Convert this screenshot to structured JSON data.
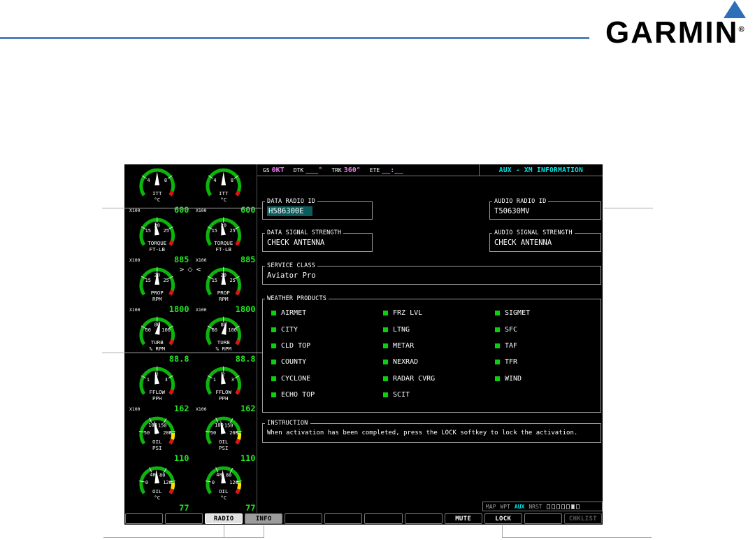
{
  "branding": {
    "logo_text": "GARMIN",
    "registered_mark": "®"
  },
  "colors": {
    "rule_blue": "#4f81bd",
    "garmin_delta_blue": "#2e6fb7",
    "accent_cyan": "#00e5e5",
    "nav_value_magenta": "#e87ae8",
    "gauge_value_green": "#23e523",
    "indicator_green": "#0ad20a",
    "cursor_highlight_teal": "#0d5c5c"
  },
  "navbar": {
    "fields": [
      {
        "label": "GS",
        "value": "0KT"
      },
      {
        "label": "DTK",
        "value": "___°"
      },
      {
        "label": "TRK",
        "value": "360°"
      },
      {
        "label": "ETE",
        "value": "__:__"
      }
    ],
    "title": "AUX - XM INFORMATION"
  },
  "eis": {
    "prop_sync": "> ◇ <",
    "rows": [
      {
        "name": "ITT",
        "unit": "°C",
        "sub": "X100",
        "ticks": [
          "4",
          "8"
        ],
        "value": "600",
        "needle": 0,
        "yellow": false,
        "sync": false
      },
      {
        "name": "TORQUE",
        "unit": "FT-LB",
        "sub": "X100",
        "ticks": [
          "15",
          "20",
          "25"
        ],
        "value": "885",
        "needle": -8,
        "yellow": false,
        "sync": false
      },
      {
        "name": "PROP",
        "unit": "RPM",
        "sub": "X100",
        "ticks": [
          "15",
          "20",
          "25"
        ],
        "value": "1800",
        "needle": 0,
        "yellow": false,
        "sync": true
      },
      {
        "name": "TURB",
        "unit": "% RPM",
        "sub": "",
        "ticks": [
          "60",
          "80",
          "100"
        ],
        "value": "88.8",
        "needle": 12,
        "yellow": false,
        "sync": false
      },
      {
        "name": "FFLOW",
        "unit": "PPH",
        "sub": "X100",
        "ticks": [
          "1",
          "2",
          "3"
        ],
        "value": "162",
        "needle": -8,
        "yellow": false,
        "sync": false
      },
      {
        "name": "OIL",
        "unit": "PSI",
        "sub": "",
        "ticks": [
          "50",
          "100",
          "150",
          "200"
        ],
        "value": "110",
        "needle": -12,
        "yellow": true,
        "sync": false
      },
      {
        "name": "OIL",
        "unit": "°C",
        "sub": "",
        "ticks": [
          "0",
          "40",
          "80",
          "120"
        ],
        "value": "77",
        "needle": -4,
        "yellow": true,
        "sync": false
      }
    ]
  },
  "fields": {
    "data_radio_id": {
      "label": "DATA RADIO ID",
      "value": "H586300E"
    },
    "audio_radio_id": {
      "label": "AUDIO RADIO ID",
      "value": "T50630MV"
    },
    "data_signal": {
      "label": "DATA SIGNAL STRENGTH",
      "value": "CHECK ANTENNA"
    },
    "audio_signal": {
      "label": "AUDIO SIGNAL STRENGTH",
      "value": "CHECK ANTENNA"
    },
    "service_class": {
      "label": "SERVICE CLASS",
      "value": "Aviator Pro"
    }
  },
  "weather_products": {
    "label": "WEATHER PRODUCTS",
    "columns": [
      [
        "AIRMET",
        "CITY",
        "CLD TOP",
        "COUNTY",
        "CYCLONE",
        "ECHO TOP"
      ],
      [
        "FRZ LVL",
        "LTNG",
        "METAR",
        "NEXRAD",
        "RADAR CVRG",
        "SCIT"
      ],
      [
        "SIGMET",
        "SFC",
        "TAF",
        "TFR",
        "WIND"
      ]
    ]
  },
  "instruction": {
    "label": "INSTRUCTION",
    "text": "When activation has been completed, press the LOCK softkey to lock the activation."
  },
  "pagebar": {
    "groups": [
      "MAP",
      "WPT",
      "AUX",
      "NRST"
    ],
    "active_group": "AUX",
    "page_count": 7,
    "active_page_index": 5
  },
  "softkeys": [
    {
      "label": ""
    },
    {
      "label": ""
    },
    {
      "label": "RADIO",
      "state": "selected-light"
    },
    {
      "label": "INFO",
      "state": "selected"
    },
    {
      "label": ""
    },
    {
      "label": ""
    },
    {
      "label": ""
    },
    {
      "label": ""
    },
    {
      "label": "MUTE"
    },
    {
      "label": "LOCK"
    },
    {
      "label": ""
    },
    {
      "label": "CHKLIST",
      "state": "disabled"
    }
  ]
}
